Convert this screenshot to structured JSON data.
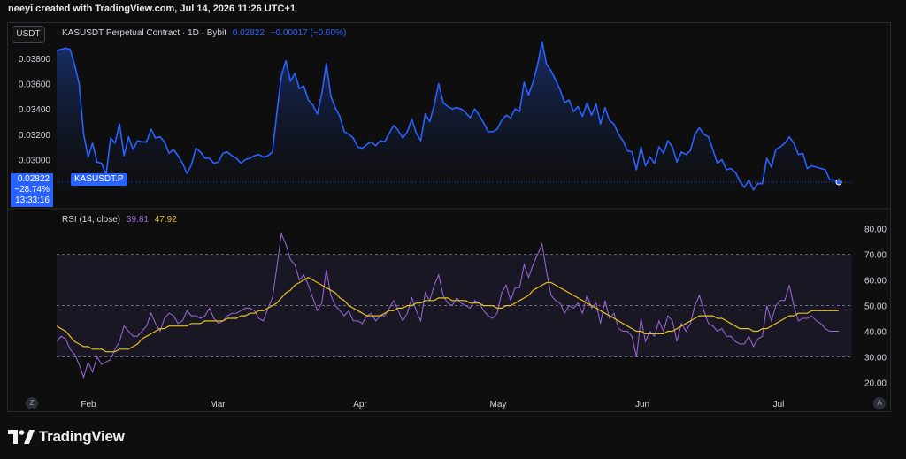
{
  "caption": "neeyi created with TradingView.com, Jul 14, 2026 11:26 UTC+1",
  "toolbar": {
    "currency": "USDT"
  },
  "legend": {
    "title": "KASUSDT Perpetual Contract · 1D · Bybit",
    "last": "0.02822",
    "change": "−0.00017 (−0.60%)"
  },
  "price_tag": {
    "price": "0.02822",
    "pct": "−28.74%",
    "countdown": "13:33:16",
    "symbol": "KASUSDT.P"
  },
  "rsi_legend": {
    "label": "RSI (14, close)",
    "rsi": "39.81",
    "ma": "47.92"
  },
  "footer": {
    "left_btn": "Z",
    "right_btn": "A",
    "brand": "TradingView"
  },
  "colors": {
    "price": "#2962ff",
    "rsi": "#9c6ade",
    "rsi_ma": "#e6c11e",
    "band": "#2a2440"
  },
  "chart_data": [
    {
      "type": "area",
      "series": [
        {
          "name": "KASUSDT.P",
          "values": [
            0.0386,
            0.0387,
            0.0388,
            0.0387,
            0.0375,
            0.036,
            0.032,
            0.0302,
            0.0313,
            0.0298,
            0.0297,
            0.0288,
            0.0317,
            0.0313,
            0.0328,
            0.0303,
            0.0318,
            0.0308,
            0.0315,
            0.0314,
            0.0314,
            0.0324,
            0.0317,
            0.0318,
            0.0314,
            0.0305,
            0.0308,
            0.0303,
            0.0297,
            0.0289,
            0.0296,
            0.0309,
            0.0306,
            0.0301,
            0.0301,
            0.0297,
            0.0298,
            0.0305,
            0.0306,
            0.0303,
            0.0301,
            0.0297,
            0.03,
            0.0301,
            0.0303,
            0.0304,
            0.0302,
            0.0303,
            0.0306,
            0.0337,
            0.0366,
            0.0378,
            0.0362,
            0.0368,
            0.0356,
            0.0358,
            0.0347,
            0.0343,
            0.0336,
            0.0352,
            0.0376,
            0.035,
            0.0341,
            0.0334,
            0.0322,
            0.032,
            0.0317,
            0.031,
            0.0309,
            0.0312,
            0.0314,
            0.0311,
            0.0315,
            0.0314,
            0.0321,
            0.0327,
            0.0323,
            0.0317,
            0.0322,
            0.0332,
            0.0321,
            0.0315,
            0.0336,
            0.033,
            0.0343,
            0.036,
            0.0345,
            0.0342,
            0.034,
            0.0341,
            0.034,
            0.0337,
            0.0333,
            0.034,
            0.0335,
            0.0329,
            0.0322,
            0.0322,
            0.0324,
            0.0331,
            0.0335,
            0.0333,
            0.034,
            0.0338,
            0.0361,
            0.0351,
            0.0361,
            0.0375,
            0.0393,
            0.0375,
            0.037,
            0.0363,
            0.0355,
            0.0345,
            0.0347,
            0.0338,
            0.0342,
            0.0334,
            0.0345,
            0.0335,
            0.0344,
            0.0328,
            0.0341,
            0.0331,
            0.0328,
            0.032,
            0.0315,
            0.0307,
            0.0306,
            0.0292,
            0.031,
            0.0295,
            0.0302,
            0.0297,
            0.031,
            0.0305,
            0.0315,
            0.031,
            0.0298,
            0.0306,
            0.0304,
            0.0307,
            0.032,
            0.0325,
            0.032,
            0.0318,
            0.0308,
            0.0297,
            0.03,
            0.0292,
            0.0293,
            0.029,
            0.0283,
            0.0278,
            0.0284,
            0.0276,
            0.0281,
            0.0281,
            0.0301,
            0.0294,
            0.0308,
            0.031,
            0.0313,
            0.0318,
            0.0313,
            0.0304,
            0.0305,
            0.0293,
            0.0295,
            0.0294,
            0.0293,
            0.0292,
            0.0284,
            0.0284,
            0.0282
          ]
        }
      ],
      "y_ticks": [
        "0.03800",
        "0.03600",
        "0.03400",
        "0.03200",
        "0.03000"
      ],
      "ylim": [
        0.0271,
        0.0405
      ],
      "x_ticks": [
        "Feb",
        "Mar",
        "Apr",
        "May",
        "Jun",
        "Jul"
      ],
      "last_value": 0.02822
    },
    {
      "type": "line",
      "title": "RSI (14, close)",
      "series": [
        {
          "name": "RSI",
          "values": [
            36,
            38,
            37,
            33,
            31,
            27,
            22,
            28,
            24,
            30,
            27,
            28,
            29,
            33,
            36,
            42,
            40,
            38,
            38,
            40,
            42,
            47,
            43,
            40,
            45,
            47,
            46,
            43,
            44,
            48,
            46,
            46,
            45,
            46,
            49,
            45,
            43,
            44,
            46,
            47,
            47,
            48,
            49,
            49,
            48,
            45,
            44,
            49,
            53,
            65,
            78,
            74,
            68,
            66,
            60,
            62,
            58,
            53,
            48,
            51,
            64,
            54,
            50,
            48,
            46,
            48,
            44,
            44,
            43,
            46,
            47,
            44,
            46,
            46,
            49,
            52,
            48,
            44,
            47,
            53,
            48,
            44,
            55,
            52,
            58,
            62,
            54,
            51,
            50,
            53,
            51,
            50,
            49,
            52,
            51,
            48,
            46,
            45,
            47,
            55,
            58,
            52,
            57,
            57,
            66,
            61,
            66,
            70,
            74,
            63,
            54,
            52,
            51,
            47,
            50,
            49,
            51,
            47,
            54,
            49,
            51,
            43,
            52,
            45,
            47,
            41,
            40,
            40,
            38,
            30,
            45,
            36,
            40,
            38,
            44,
            40,
            46,
            44,
            36,
            43,
            40,
            43,
            50,
            54,
            48,
            43,
            42,
            40,
            41,
            38,
            38,
            36,
            35,
            35,
            38,
            34,
            37,
            38,
            50,
            44,
            50,
            52,
            52,
            58,
            50,
            44,
            45,
            45,
            46,
            44,
            43,
            41,
            40,
            40,
            40
          ]
        },
        {
          "name": "RSI-based MA",
          "values": [
            42,
            41,
            40,
            38,
            36,
            35,
            34,
            34,
            33,
            33,
            33,
            32,
            32,
            32,
            33,
            33,
            33,
            34,
            35,
            37,
            38,
            39,
            40,
            41,
            41,
            42,
            42,
            42,
            42,
            42,
            43,
            43,
            43,
            44,
            44,
            44,
            44,
            44,
            45,
            45,
            45,
            46,
            46,
            47,
            47,
            48,
            48,
            49,
            50,
            51,
            53,
            55,
            56,
            58,
            59,
            60,
            61,
            60,
            59,
            58,
            57,
            56,
            55,
            53,
            52,
            50,
            49,
            48,
            47,
            46,
            46,
            46,
            46,
            47,
            48,
            48,
            49,
            49,
            50,
            50,
            51,
            51,
            52,
            52,
            52,
            53,
            53,
            53,
            52,
            52,
            52,
            52,
            51,
            51,
            51,
            50,
            50,
            50,
            49,
            49,
            50,
            50,
            51,
            52,
            53,
            54,
            56,
            57,
            58,
            59,
            59,
            58,
            57,
            56,
            55,
            54,
            53,
            52,
            51,
            50,
            49,
            48,
            47,
            46,
            45,
            44,
            43,
            42,
            41,
            40,
            40,
            39,
            39,
            39,
            39,
            39,
            40,
            40,
            41,
            42,
            43,
            44,
            45,
            46,
            46,
            46,
            46,
            45,
            45,
            44,
            43,
            42,
            41,
            41,
            41,
            40,
            40,
            41,
            41,
            42,
            43,
            44,
            45,
            46,
            46,
            47,
            47,
            47,
            48,
            48,
            48,
            48,
            48,
            48,
            48
          ]
        }
      ],
      "y_ticks": [
        "80.00",
        "70.00",
        "60.00",
        "50.00",
        "40.00",
        "30.00",
        "20.00"
      ],
      "ylim": [
        16,
        83
      ],
      "bands": {
        "upper": 70,
        "middle": 50,
        "lower": 30
      }
    }
  ]
}
